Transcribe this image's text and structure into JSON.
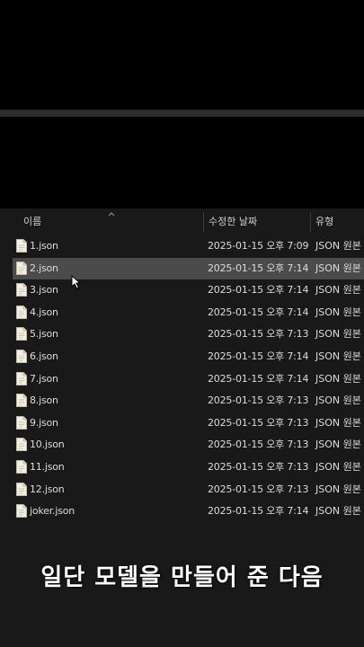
{
  "header": {
    "col_name": "이름",
    "col_date": "수정한 날짜",
    "col_type": "유형"
  },
  "files": [
    {
      "name": "1.json",
      "date": "2025-01-15 오후 7:09",
      "type": "JSON 원본 파"
    },
    {
      "name": "2.json",
      "date": "2025-01-15 오후 7:14",
      "type": "JSON 원본 파",
      "selected": true
    },
    {
      "name": "3.json",
      "date": "2025-01-15 오후 7:14",
      "type": "JSON 원본 파"
    },
    {
      "name": "4.json",
      "date": "2025-01-15 오후 7:14",
      "type": "JSON 원본 파"
    },
    {
      "name": "5.json",
      "date": "2025-01-15 오후 7:13",
      "type": "JSON 원본 파"
    },
    {
      "name": "6.json",
      "date": "2025-01-15 오후 7:14",
      "type": "JSON 원본 파"
    },
    {
      "name": "7.json",
      "date": "2025-01-15 오후 7:14",
      "type": "JSON 원본 파"
    },
    {
      "name": "8.json",
      "date": "2025-01-15 오후 7:13",
      "type": "JSON 원본 파"
    },
    {
      "name": "9.json",
      "date": "2025-01-15 오후 7:13",
      "type": "JSON 원본 파"
    },
    {
      "name": "10.json",
      "date": "2025-01-15 오후 7:13",
      "type": "JSON 원본 파"
    },
    {
      "name": "11.json",
      "date": "2025-01-15 오후 7:13",
      "type": "JSON 원본 파"
    },
    {
      "name": "12.json",
      "date": "2025-01-15 오후 7:13",
      "type": "JSON 원본 파"
    },
    {
      "name": "joker.json",
      "date": "2025-01-15 오후 7:14",
      "type": "JSON 원본 파"
    }
  ],
  "caption": "일단 모델을 만들어 준 다음",
  "colors": {
    "background": "#191919",
    "selected_row": "#4b4b4b",
    "text": "#dcdcdc"
  }
}
